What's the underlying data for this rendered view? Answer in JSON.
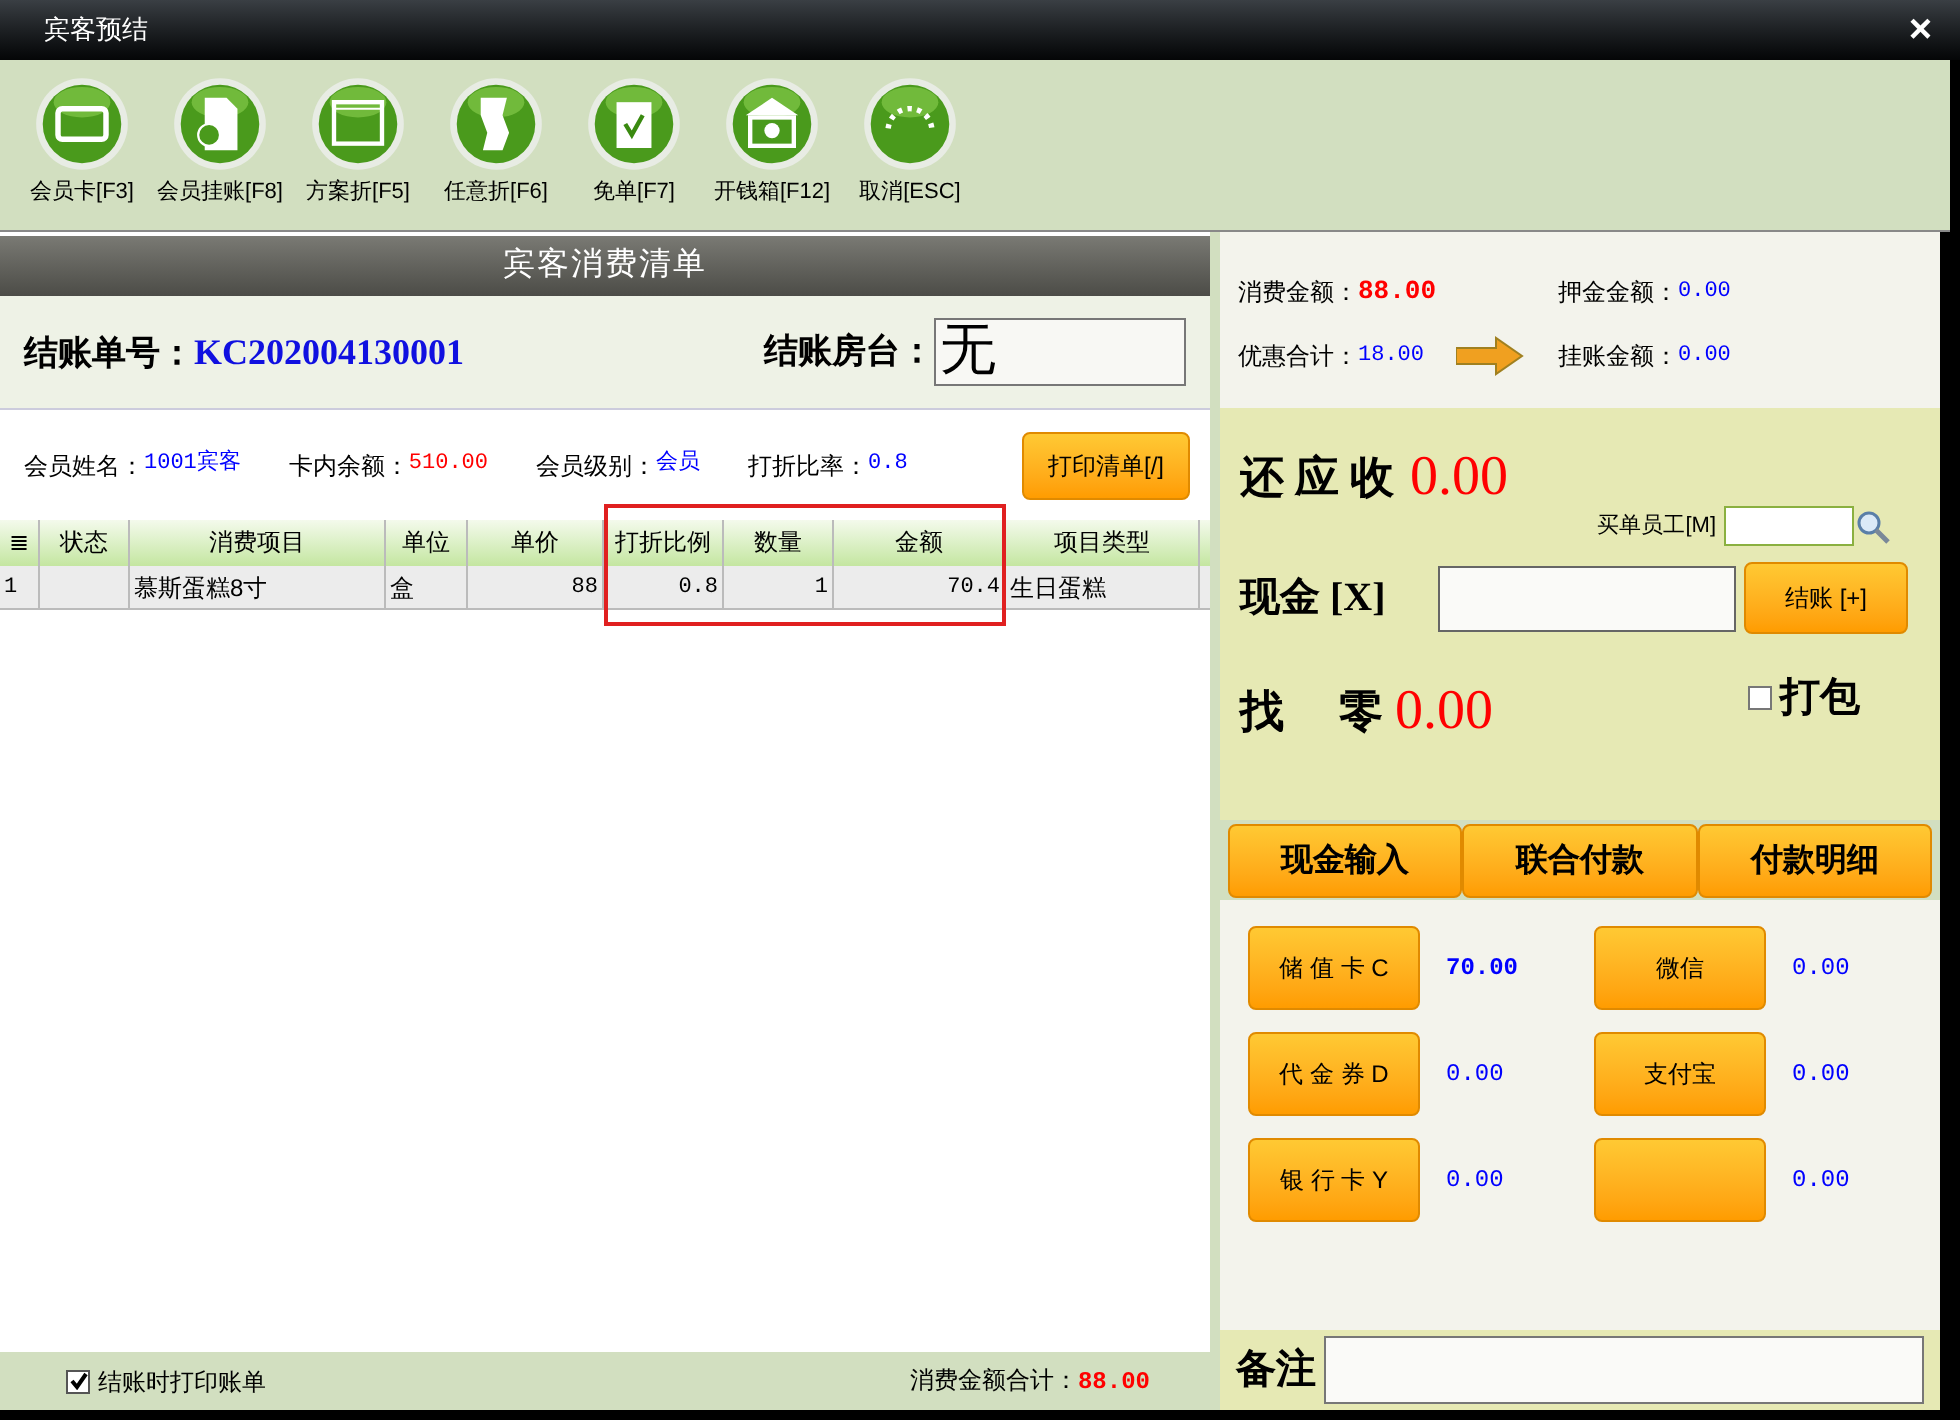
{
  "window": {
    "title": "宾客预结",
    "close": "×"
  },
  "toolbar": [
    {
      "kind": "card",
      "label": "会员卡[F3]"
    },
    {
      "kind": "document",
      "label": "会员挂账[F8]"
    },
    {
      "kind": "window",
      "label": "方案折[F5]"
    },
    {
      "kind": "paper",
      "label": "任意折[F6]"
    },
    {
      "kind": "clipboard",
      "label": "免单[F7]"
    },
    {
      "kind": "bank",
      "label": "开钱箱[F12]"
    },
    {
      "kind": "ring",
      "label": "取消[ESC]"
    }
  ],
  "bill": {
    "header": "宾客消费清单",
    "number_label": "结账单号：",
    "number": "KC202004130001",
    "room_label": "结账房台：",
    "room": "无"
  },
  "member": [
    {
      "label": "会员姓名：",
      "value": "1001宾客",
      "color": "#0000ff"
    },
    {
      "label": "卡内余额：",
      "value": "510.00",
      "color": "#ff0000"
    },
    {
      "label": "会员级别：",
      "value": "会员",
      "color": "#0000ff"
    },
    {
      "label": "打折比率：",
      "value": "0.8",
      "color": "#0000ff"
    }
  ],
  "print_list_button": "打印清单[/]",
  "table": {
    "columns": [
      "≣",
      "状态",
      "消费项目",
      "单位",
      "单价",
      "打折比例",
      "数量",
      "金额",
      "项目类型"
    ],
    "rows": [
      [
        "1",
        "",
        "慕斯蛋糕8寸",
        "盒",
        "88",
        "0.8",
        "1",
        "70.4",
        "生日蛋糕"
      ]
    ]
  },
  "footer": {
    "print_on_checkout": {
      "label": "结账时打印账单",
      "checked": true
    },
    "total_label": "消费金额合计：",
    "total": "88.00"
  },
  "summary": [
    {
      "label": "消费金额：",
      "value": "88.00",
      "color": "#ff0000"
    },
    {
      "label": "押金金额：",
      "value": "0.00",
      "color": "#0000ff"
    },
    {
      "label": "优惠合计：",
      "value": "18.00",
      "color": "#0000ff"
    },
    {
      "label": "挂账金额：",
      "value": "0.00",
      "color": "#0000ff"
    }
  ],
  "due": {
    "label": "还 应 收",
    "value": "0.00"
  },
  "staff": {
    "label": "买单员工[M]"
  },
  "cash": {
    "label": "现金 [X]"
  },
  "checkout_button": "结账 [+]",
  "change": {
    "label": "找     零",
    "value": "0.00"
  },
  "pack": {
    "label": "打包",
    "checked": false
  },
  "modes": [
    "现金输入",
    "联合付款",
    "付款明细"
  ],
  "payments": [
    {
      "label": "储 值 卡 C",
      "value": "70.00",
      "bold": true
    },
    {
      "label": "微信",
      "value": "0.00",
      "bold": false
    },
    {
      "label": "代 金 券 D",
      "value": "0.00",
      "bold": false
    },
    {
      "label": "支付宝",
      "value": "0.00",
      "bold": false
    },
    {
      "label": "银 行 卡 Y",
      "value": "0.00",
      "bold": false
    },
    {
      "value": "0.00",
      "bold": false
    }
  ],
  "remark": {
    "label": "备注"
  }
}
